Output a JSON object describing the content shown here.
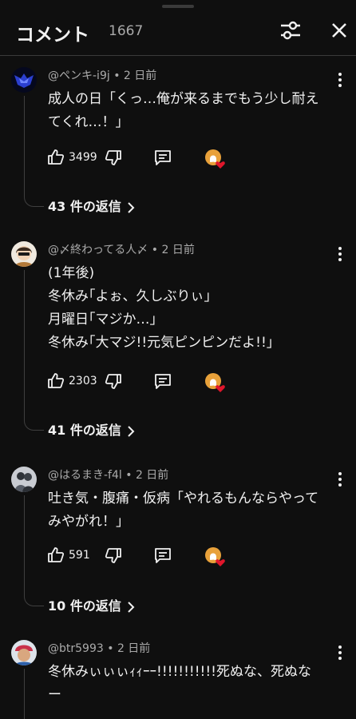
{
  "header": {
    "title": "コメント",
    "count": "1667"
  },
  "comments": [
    {
      "author": "@ペンキ-i9j",
      "age": "2 日前",
      "lines": [
        "成人の日「くっ…俺が来るまでもう少し耐え",
        "てくれ…！」"
      ],
      "likes": "3499",
      "replies": "43 件の返信",
      "avatar_color": "#1b2a8a"
    },
    {
      "author": "@〆終わってる人〆",
      "age": "2 日前",
      "lines": [
        "(1年後)",
        "冬休み｢よぉ、久しぶりぃ｣",
        "月曜日｢マジか…｣",
        "冬休み｢大マジ!!元気ピンピンだよ!!｣"
      ],
      "likes": "2303",
      "replies": "41 件の返信",
      "avatar_color": "#d8cfc2"
    },
    {
      "author": "@はるまき-f4l",
      "age": "2 日前",
      "lines": [
        "吐き気・腹痛・仮病「やれるもんならやって",
        "みやがれ！」"
      ],
      "likes": "591",
      "replies": "10 件の返信",
      "avatar_color": "#b9bcc4"
    },
    {
      "author": "@btr5993",
      "age": "2 日前",
      "lines": [
        "冬休みぃぃぃｨｨｰｰ!!!!!!!!!!!死ぬな、死ぬな",
        "ー"
      ],
      "avatar_color": "#c9314a"
    }
  ],
  "icons": {
    "filter": "tune-icon",
    "close": "close-icon",
    "more": "more-vert-icon",
    "like": "thumb-up-icon",
    "dislike": "thumb-down-icon",
    "reply": "comment-icon",
    "heart": "creator-heart-icon",
    "chevron": "chevron-right-icon"
  },
  "colors": {
    "background": "#0f0f0f",
    "text": "#f1f1f1",
    "secondary": "#aaaaaa",
    "heart": "#e0162b"
  }
}
